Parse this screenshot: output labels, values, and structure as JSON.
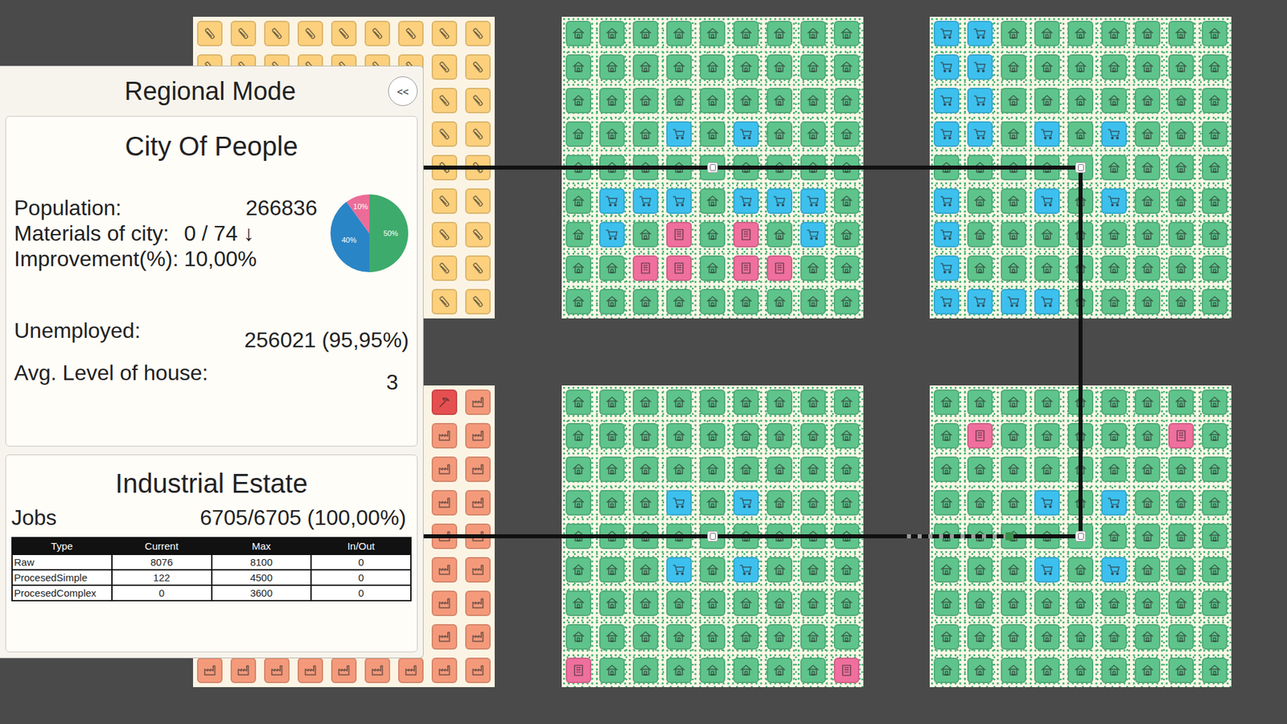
{
  "panel": {
    "title": "Regional Mode",
    "collapse_button": "<<",
    "city": {
      "name": "City Of People",
      "stats": [
        {
          "label": "Population:",
          "value": "266836"
        },
        {
          "label": "Materials of city:",
          "value": "0 / 74 ↓"
        },
        {
          "label": "Improvement(%):",
          "value": "10,00%"
        }
      ],
      "pie": {
        "values": [
          50,
          40,
          10
        ],
        "labels": [
          "50%",
          "40%",
          "10%"
        ],
        "colors": [
          "#3dab6b",
          "#2a85c6",
          "#ec6c98"
        ]
      },
      "unemployed": {
        "label": "Unemployed:",
        "value": "256021 (95,95%)"
      },
      "avg_house": {
        "label": "Avg. Level of house:",
        "value": "3"
      }
    },
    "industry": {
      "name": "Industrial Estate",
      "jobs_label": "Jobs",
      "jobs_value": "6705/6705 (100,00%)",
      "table": {
        "columns": [
          "Type",
          "Current",
          "Max",
          "In/Out"
        ],
        "rows": [
          [
            "Raw",
            "8076",
            "8100",
            "0"
          ],
          [
            "ProcesedSimple",
            "122",
            "4500",
            "0"
          ],
          [
            "ProcesedComplex",
            "0",
            "3600",
            "0"
          ]
        ]
      }
    }
  },
  "map": {
    "tile_kinds": {
      "R": {
        "kind": "resource",
        "color": "#fcd07c"
      },
      "H": {
        "kind": "house",
        "color": "#5ec48b"
      },
      "S": {
        "kind": "shop",
        "color": "#3dc0ee"
      },
      "O": {
        "kind": "office",
        "color": "#ef6f9d"
      },
      "F": {
        "kind": "factory",
        "color": "#f49a7b"
      },
      "M": {
        "kind": "mine",
        "color": "#e64f4f"
      }
    },
    "districts": [
      {
        "kind": "resource",
        "rows": [
          "RRRRRRRRR",
          "RRRRRRRRR",
          "RRRRRRRRR",
          "RRRRRRRRR",
          "RRRRRRRRR",
          "RRRRRRRRR",
          "RRRRRRRRR",
          "RRRRRRRRR",
          "RRRRRRRRR"
        ]
      },
      {
        "kind": "residential",
        "rows": [
          "HHHHHHHHH",
          "HHHHHHHHH",
          "HHHHHHHHH",
          "HHHSHSHHH",
          "HHHHHHHHH",
          "HSSSHSSSH",
          "HSHOHOHSH",
          "HHOOHOOHH",
          "HHHHHHHHH"
        ]
      },
      {
        "kind": "residential",
        "rows": [
          "SSHHHHHHH",
          "SSHHHHHHH",
          "SSHHHHHHH",
          "SSHSHSHHH",
          "HHHHHHHHH",
          "SHHSHSHHH",
          "SHHHHHHHH",
          "SHHHHHHHH",
          "SSSSHHHHH"
        ]
      },
      {
        "kind": "industrial",
        "rows": [
          "FFFFFFFMF",
          "FFFFFFFFF",
          "FFFFFFFFF",
          "FFFFFFFFF",
          "FFFFFFFFF",
          "FFFFFFFFF",
          "FFFFFFFFF",
          "FFFFFFFFF",
          "FFFFFFFFF"
        ]
      },
      {
        "kind": "residential",
        "rows": [
          "HHHHHHHHH",
          "HHHHHHHHH",
          "HHHHHHHHH",
          "HHHSHSHHH",
          "HHHHHHHHH",
          "HHHSHSHHH",
          "HHHHHHHHH",
          "HHHHHHHHH",
          "OHHHHHHHO"
        ]
      },
      {
        "kind": "residential",
        "rows": [
          "HHHHHHHHH",
          "HOHHHHHOH",
          "HHHHHHHHH",
          "HHHSHSHHH",
          "HHHHHHHHH",
          "HHHSHSHHH",
          "HHHHHHHHH",
          "HHHHHHHHH",
          "HHHHHHHHH"
        ]
      }
    ]
  }
}
